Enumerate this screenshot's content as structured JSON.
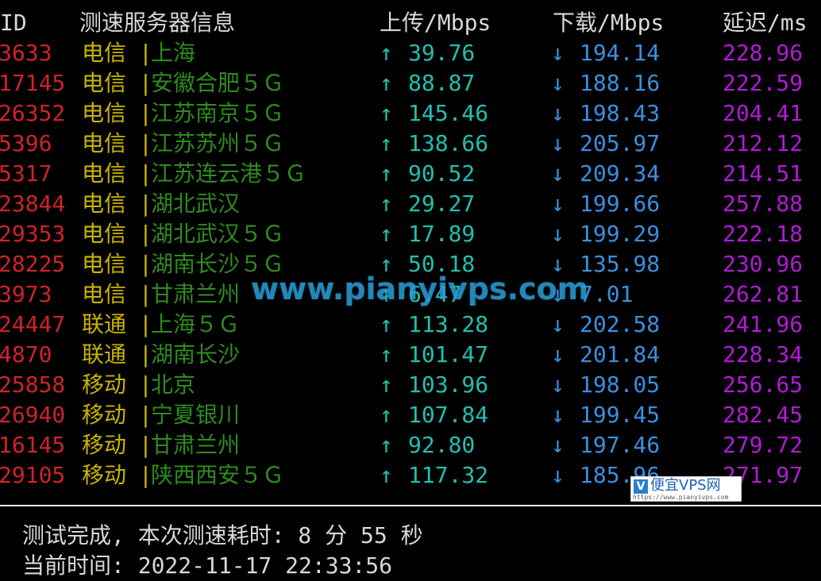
{
  "header": {
    "id": "ID",
    "server": "测速服务器信息",
    "upload": "上传/Mbps",
    "download": "下载/Mbps",
    "latency": "延迟/ms"
  },
  "arrows": {
    "up": "↑",
    "down": "↓"
  },
  "separator": "|",
  "rows": [
    {
      "id": "3633",
      "isp": "电信",
      "city": "上海",
      "up": "39.76",
      "down": "194.14",
      "latency": "228.96"
    },
    {
      "id": "17145",
      "isp": "电信",
      "city": "安徽合肥５Ｇ",
      "up": "88.87",
      "down": "188.16",
      "latency": "222.59"
    },
    {
      "id": "26352",
      "isp": "电信",
      "city": "江苏南京５Ｇ",
      "up": "145.46",
      "down": "198.43",
      "latency": "204.41"
    },
    {
      "id": "5396",
      "isp": "电信",
      "city": "江苏苏州５Ｇ",
      "up": "138.66",
      "down": "205.97",
      "latency": "212.12"
    },
    {
      "id": "5317",
      "isp": "电信",
      "city": "江苏连云港５Ｇ",
      "up": "90.52",
      "down": "209.34",
      "latency": "214.51"
    },
    {
      "id": "23844",
      "isp": "电信",
      "city": "湖北武汉",
      "up": "29.27",
      "down": "199.66",
      "latency": "257.88"
    },
    {
      "id": "29353",
      "isp": "电信",
      "city": "湖北武汉５Ｇ",
      "up": "17.89",
      "down": "199.29",
      "latency": "222.18"
    },
    {
      "id": "28225",
      "isp": "电信",
      "city": "湖南长沙５Ｇ",
      "up": "50.18",
      "down": "135.98",
      "latency": "230.96"
    },
    {
      "id": "3973",
      "isp": "电信",
      "city": "甘肃兰州",
      "up": "6.47",
      "down": "7.01",
      "latency": "262.81"
    },
    {
      "id": "24447",
      "isp": "联通",
      "city": "上海５Ｇ",
      "up": "113.28",
      "down": "202.58",
      "latency": "241.96"
    },
    {
      "id": "4870",
      "isp": "联通",
      "city": "湖南长沙",
      "up": "101.47",
      "down": "201.84",
      "latency": "228.34"
    },
    {
      "id": "25858",
      "isp": "移动",
      "city": "北京",
      "up": "103.96",
      "down": "198.05",
      "latency": "256.65"
    },
    {
      "id": "26940",
      "isp": "移动",
      "city": "宁夏银川",
      "up": "107.84",
      "down": "199.45",
      "latency": "282.45"
    },
    {
      "id": "16145",
      "isp": "移动",
      "city": "甘肃兰州",
      "up": "92.80",
      "down": "197.46",
      "latency": "279.72"
    },
    {
      "id": "29105",
      "isp": "移动",
      "city": "陕西西安５Ｇ",
      "up": "117.32",
      "down": "185.96",
      "latency": "271.97"
    }
  ],
  "footer": {
    "line1": "测试完成, 本次测速耗时: 8 分 55 秒",
    "line2": "当前时间: 2022-11-17 22:33:56"
  },
  "watermark": "www.pianyivps.com",
  "badge": {
    "title": "便宜VPS网",
    "url": "https://www.pianyivps.com",
    "v": "V"
  }
}
